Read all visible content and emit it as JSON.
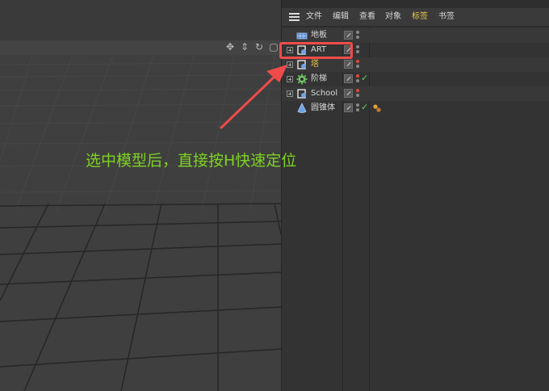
{
  "menu": {
    "items": [
      {
        "label": "文件",
        "active": false
      },
      {
        "label": "编辑",
        "active": false
      },
      {
        "label": "查看",
        "active": false
      },
      {
        "label": "对象",
        "active": false
      },
      {
        "label": "标签",
        "active": true
      },
      {
        "label": "书签",
        "active": false
      }
    ]
  },
  "objects": [
    {
      "label": "地板",
      "icon": "floor-plane-icon",
      "expander": false,
      "highlight": false,
      "dots": [
        "gray",
        "gray"
      ],
      "check": false,
      "tag": false
    },
    {
      "label": "ART",
      "icon": "null-object-icon",
      "expander": true,
      "highlight": false,
      "dots": [
        "gray",
        "gray"
      ],
      "check": false,
      "tag": false
    },
    {
      "label": "塔",
      "icon": "null-object-icon",
      "expander": true,
      "highlight": true,
      "dots": [
        "red",
        "gray"
      ],
      "check": false,
      "tag": false
    },
    {
      "label": "阶梯",
      "icon": "gear-object-icon",
      "expander": true,
      "highlight": false,
      "dots": [
        "red",
        "gray"
      ],
      "check": true,
      "tag": false
    },
    {
      "label": "School",
      "icon": "null-object-icon",
      "expander": true,
      "highlight": false,
      "dots": [
        "red",
        "gray"
      ],
      "check": false,
      "tag": false
    },
    {
      "label": "圆锥体",
      "icon": "cone-icon",
      "expander": false,
      "highlight": false,
      "dots": [
        "gray",
        "gray"
      ],
      "check": true,
      "tag": true
    }
  ],
  "annotation": {
    "text": "选中模型后，直接按H快速定位",
    "color": "#7ed321",
    "highlight_color": "#ef4b4b"
  },
  "viewport": {
    "nav_icons": [
      "move-icon",
      "zoom-icon",
      "rotate-icon",
      "maximize-icon"
    ]
  },
  "colors": {
    "accent": "#e8c64a",
    "check": "#5fd45f"
  }
}
